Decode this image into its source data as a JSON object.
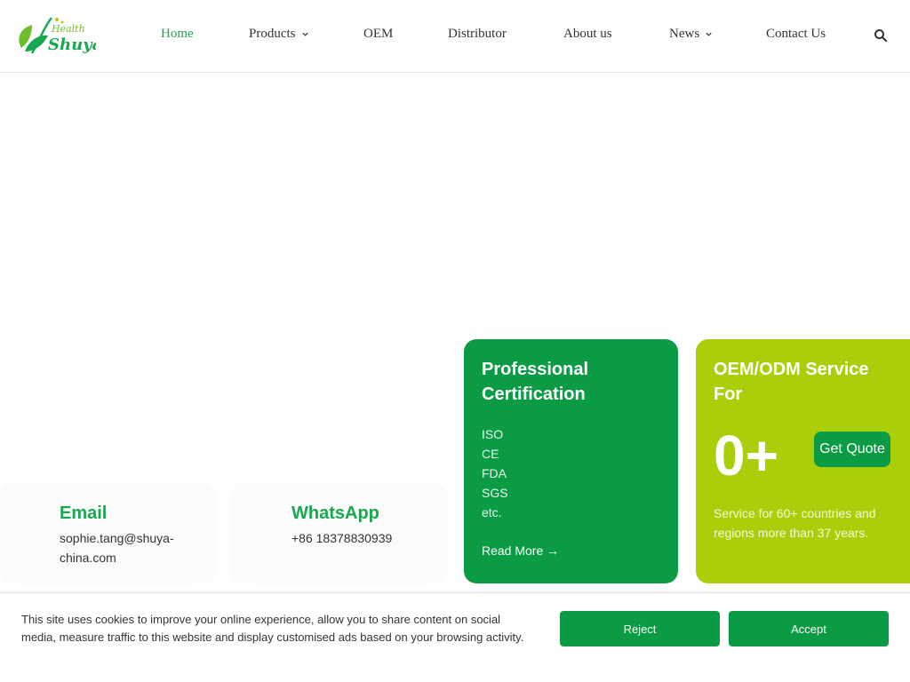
{
  "brand": {
    "logo_script": "Health",
    "logo_name": "Shuya",
    "colors": {
      "primary_green": "#0a9b44",
      "lime": "#a8cf0a",
      "nav_active": "#19a84f"
    }
  },
  "nav": {
    "items": [
      {
        "label": "Home",
        "active": true
      },
      {
        "label": "Products",
        "has_dropdown": true
      },
      {
        "label": "OEM"
      },
      {
        "label": "Distributor"
      },
      {
        "label": "About us"
      },
      {
        "label": "News",
        "has_dropdown": true
      },
      {
        "label": "Contact Us"
      }
    ],
    "search_icon": "search-icon"
  },
  "contact": {
    "email": {
      "title": "Email",
      "value": "sophie.tang@shuya-china.com"
    },
    "whatsapp": {
      "title": "WhatsApp",
      "value": "+86 18378830939"
    }
  },
  "certification": {
    "title": "Professional Certification",
    "items": [
      "ISO",
      "CE",
      "FDA",
      "SGS",
      "etc."
    ],
    "read_more": "Read More →"
  },
  "oem": {
    "title": "OEM/ODM Service For",
    "count": "0+",
    "button": "Get Quote",
    "description": "Service for 60+ countries and regions more than 37 years."
  },
  "cookie": {
    "text": "This site uses cookies to improve your online experience, allow you to share content on social media, measure traffic to this website and display customised ads based on your browsing activity.",
    "reject": "Reject",
    "accept": "Accept"
  }
}
